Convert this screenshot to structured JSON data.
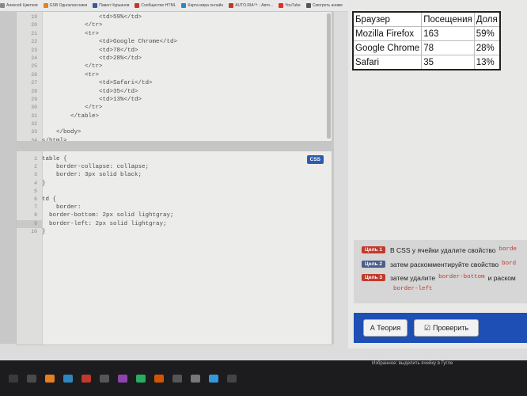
{
  "bookmarks": [
    {
      "label": "Алексей Цветков",
      "color": "#888888"
    },
    {
      "label": "GSB Одноклассники",
      "color": "#e67e22"
    },
    {
      "label": "Павел Чурьинов",
      "color": "#3b5998"
    },
    {
      "label": "Сообщество HTML",
      "color": "#c0392b"
    },
    {
      "label": "Карта мира онлайн",
      "color": "#2e86c1"
    },
    {
      "label": "AUTO.RIA™ - Авто...",
      "color": "#c0392b"
    },
    {
      "label": "YouTube",
      "color": "#e52d27"
    },
    {
      "label": "Смотреть аниме",
      "color": "#555555"
    },
    {
      "label": "Погода",
      "color": "#2e86c1"
    },
    {
      "label": "Pocket Birthcare",
      "color": "#d35400"
    },
    {
      "label": "Speedtest",
      "color": "#27ae60"
    },
    {
      "label": "Сохранения",
      "color": "#7f8c8d"
    }
  ],
  "html_editor": {
    "lines": [
      {
        "n": "19",
        "code": "                <td>59%</td>"
      },
      {
        "n": "20",
        "code": "            </tr>"
      },
      {
        "n": "21",
        "code": "            <tr>"
      },
      {
        "n": "22",
        "code": "                <td>Google Chrome</td>"
      },
      {
        "n": "23",
        "code": "                <td>78</td>"
      },
      {
        "n": "24",
        "code": "                <td>28%</td>"
      },
      {
        "n": "25",
        "code": "            </tr>"
      },
      {
        "n": "26",
        "code": "            <tr>"
      },
      {
        "n": "27",
        "code": "                <td>Safari</td>"
      },
      {
        "n": "28",
        "code": "                <td>35</td>"
      },
      {
        "n": "29",
        "code": "                <td>13%</td>"
      },
      {
        "n": "30",
        "code": "            </tr>"
      },
      {
        "n": "31",
        "code": "        </table>"
      },
      {
        "n": "32",
        "code": ""
      },
      {
        "n": "33",
        "code": "    </body>"
      },
      {
        "n": "34",
        "code": "</html>"
      }
    ]
  },
  "css_editor": {
    "badge": "CSS",
    "lines": [
      {
        "n": "1",
        "code": "table {"
      },
      {
        "n": "2",
        "code": "    border-collapse: collapse;"
      },
      {
        "n": "3",
        "code": "    border: 3px solid black;"
      },
      {
        "n": "4",
        "code": "}"
      },
      {
        "n": "5",
        "code": ""
      },
      {
        "n": "6",
        "code": "td {"
      },
      {
        "n": "7",
        "code": "    border:"
      },
      {
        "n": "8",
        "code": "  border-bottom: 2px solid lightgray;"
      },
      {
        "n": "9",
        "code": "  border-left: 2px solid lightgray;"
      },
      {
        "n": "10",
        "code": "}"
      }
    ]
  },
  "result_table": {
    "rows": [
      [
        "Браузер",
        "Посещения",
        "Доля"
      ],
      [
        "Mozilla Firefox",
        "163",
        "59%"
      ],
      [
        "Google Chrome",
        "78",
        "28%"
      ],
      [
        "Safari",
        "35",
        "13%"
      ]
    ]
  },
  "tasks": [
    {
      "badge": "Цель 1",
      "badge_color": "red",
      "text": "В CSS у ячейки удалите свойство",
      "code": "borde"
    },
    {
      "badge": "Цель 2",
      "badge_color": "blue",
      "text": "затем раскомментируйте свойство",
      "code": "bord"
    },
    {
      "badge": "Цель 3",
      "badge_color": "red",
      "text": "затем удалите",
      "code": "border-bottom",
      "text2": "и раском",
      "code2": "border-left"
    }
  ],
  "buttons": {
    "theory": "А Теория",
    "check": "Проверить"
  },
  "taskbar_icons": [
    "#3a3a3a",
    "#4a4a4a",
    "#e67e22",
    "#2e86c1",
    "#c0392b",
    "#555555",
    "#8e44ad",
    "#27ae60",
    "#d35400",
    "#555555",
    "#777777",
    "#3498db",
    "#444444"
  ],
  "bottom_text": "Избранное: выделить ячейку в Гугле"
}
